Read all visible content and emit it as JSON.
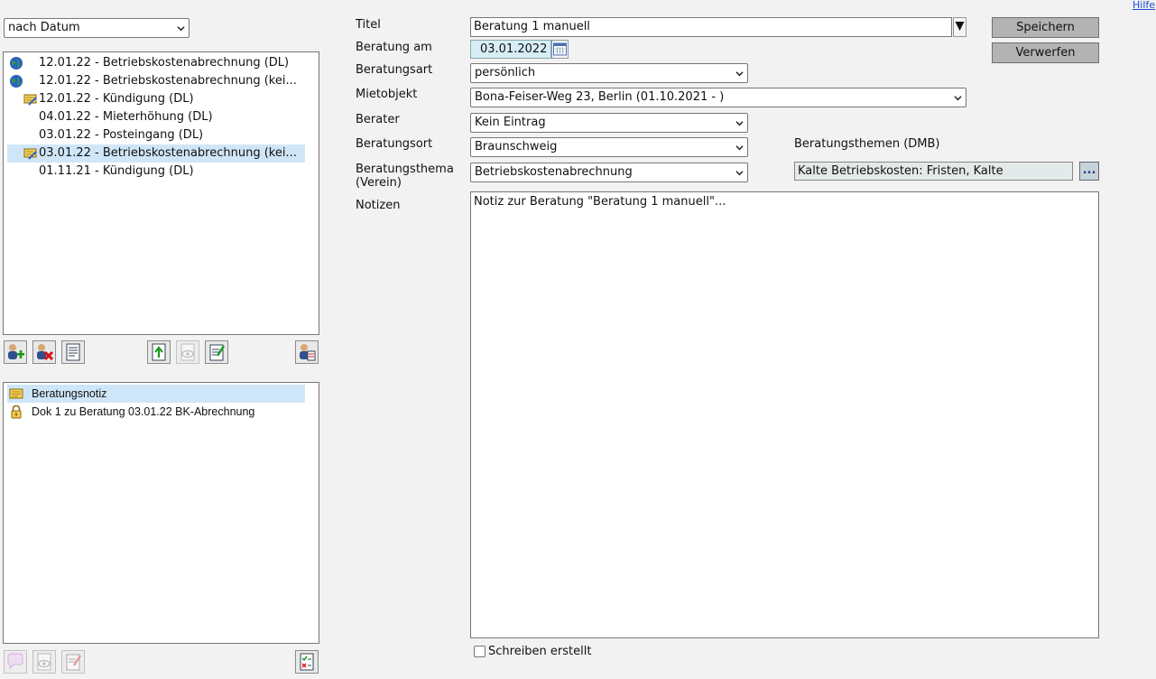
{
  "header": {
    "help_link": "Hilfe"
  },
  "sort_select": {
    "value": "nach Datum"
  },
  "consultations": [
    {
      "label": "12.01.22 - Betriebskostenabrechnung (DL)",
      "icon": "globe-icon",
      "selected": false
    },
    {
      "label": "12.01.22 - Betriebskostenabrechnung (kei...",
      "icon": "globe-icon",
      "selected": false
    },
    {
      "label": "12.01.22 - Kündigung (DL)",
      "icon": "note-pen-icon",
      "selected": false
    },
    {
      "label": "04.01.22 - Mieterhöhung (DL)",
      "icon": "",
      "selected": false
    },
    {
      "label": "03.01.22 - Posteingang (DL)",
      "icon": "",
      "selected": false
    },
    {
      "label": "03.01.22 - Betriebskostenabrechnung (kei...",
      "icon": "note-pen-icon",
      "selected": true
    },
    {
      "label": "01.11.21 - Kündigung (DL)",
      "icon": "",
      "selected": false
    }
  ],
  "documents": [
    {
      "label": "Beratungsnotiz",
      "icon": "note-icon",
      "selected": true
    },
    {
      "label": "Dok 1 zu Beratung 03.01.22 BK-Abrechnung",
      "icon": "lock-icon",
      "selected": false
    }
  ],
  "form": {
    "title_label": "Titel",
    "title_value": "Beratung 1 manuell",
    "date_label": "Beratung am",
    "date_value": "03.01.2022",
    "type_label": "Beratungsart",
    "type_value": "persönlich",
    "object_label": "Mietobjekt",
    "object_value": "Bona-Feiser-Weg 23, Berlin (01.10.2021 - )",
    "advisor_label": "Berater",
    "advisor_value": "Kein Eintrag",
    "place_label": "Beratungsort",
    "place_value": "Braunschweig",
    "topic_label_line1": "Beratungsthema",
    "topic_label_line2": "(Verein)",
    "topic_value": "Betriebskostenabrechnung",
    "dmb_label": "Beratungsthemen (DMB)",
    "dmb_value": "Kalte Betriebskosten: Fristen, Kalte",
    "dmb_button": "...",
    "notes_label": "Notizen",
    "notes_value": "Notiz zur Beratung \"Beratung 1 manuell\"...",
    "letter_label": "Schreiben erstellt",
    "letter_checked": false
  },
  "actions": {
    "save": "Speichern",
    "discard": "Verwerfen"
  },
  "colors": {
    "selection": "#cfe6f8",
    "button_gray": "#b3b3b3",
    "date_bg": "#d7eef7"
  }
}
